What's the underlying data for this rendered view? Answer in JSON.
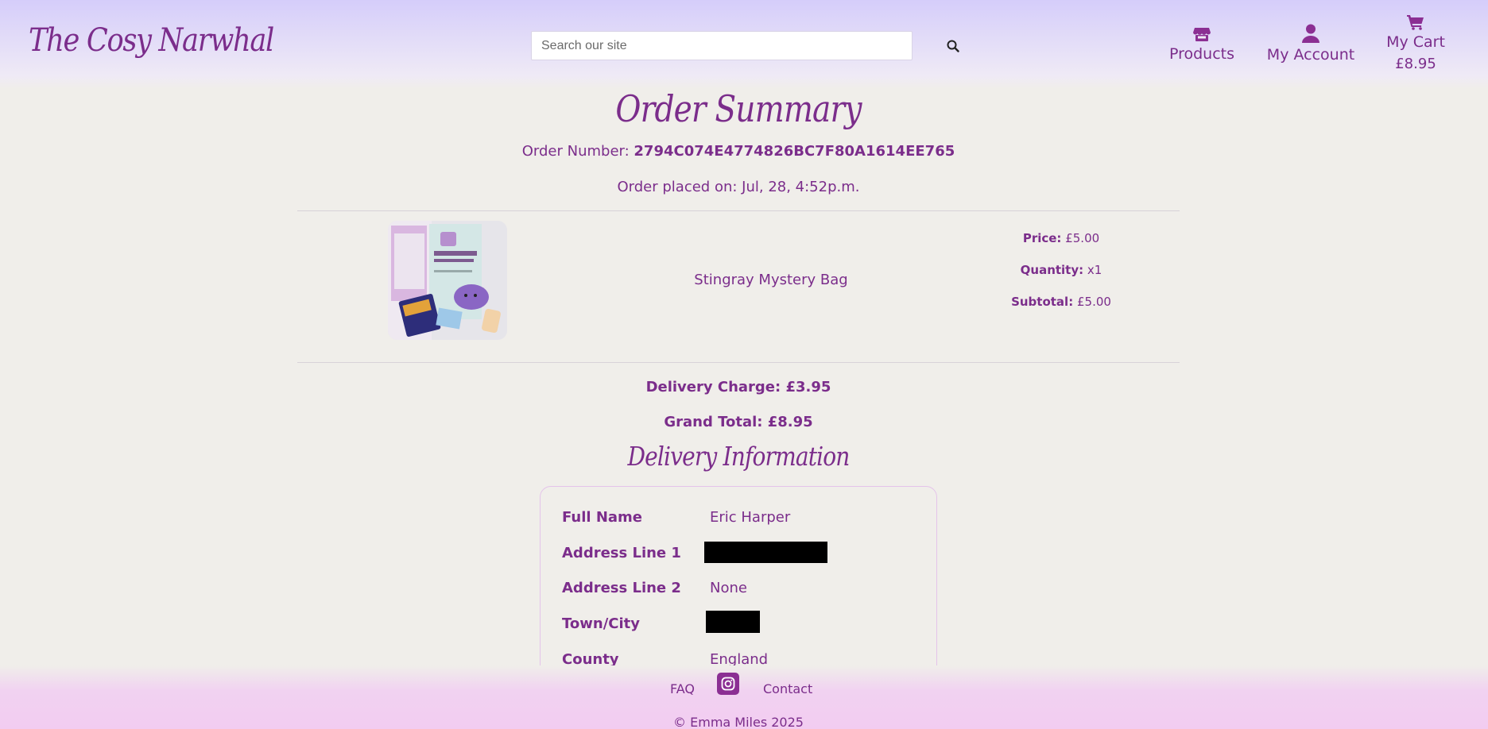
{
  "header": {
    "logo": "The Cosy Narwhal",
    "search": {
      "placeholder": "Search our site"
    },
    "nav": {
      "products": "Products",
      "account": "My Account",
      "cart": "My Cart",
      "cart_total": "£8.95"
    }
  },
  "order": {
    "title": "Order Summary",
    "number_label": "Order Number:",
    "number": "2794C074E4774826BC7F80A1614EE765",
    "placed_on": "Order placed on: Jul, 28, 4:52p.m."
  },
  "item": {
    "name": "Stingray Mystery Bag",
    "image_icon": "product-photo",
    "price_label": "Price:",
    "price": "£5.00",
    "quantity_label": "Quantity:",
    "quantity": "x1",
    "subtotal_label": "Subtotal:",
    "subtotal": "£5.00"
  },
  "totals": {
    "delivery": "Delivery Charge: £3.95",
    "grand": "Grand Total: £8.95"
  },
  "delivery": {
    "title": "Delivery Information",
    "rows": [
      {
        "label": "Full Name",
        "value": "Eric Harper"
      },
      {
        "label": "Address Line 1",
        "value": ""
      },
      {
        "label": "Address Line 2",
        "value": "None"
      },
      {
        "label": "Town/City",
        "value": ""
      },
      {
        "label": "County",
        "value": "England"
      }
    ]
  },
  "footer": {
    "faq": "FAQ",
    "contact": "Contact",
    "social_icon": "instagram-icon",
    "copyright": "© Emma Miles 2025"
  },
  "colors": {
    "brand": "#7b2d8b",
    "header_gradient_top": "#d5cdfa",
    "footer_gradient": "#f2ccf1",
    "background": "#f0eeea"
  }
}
